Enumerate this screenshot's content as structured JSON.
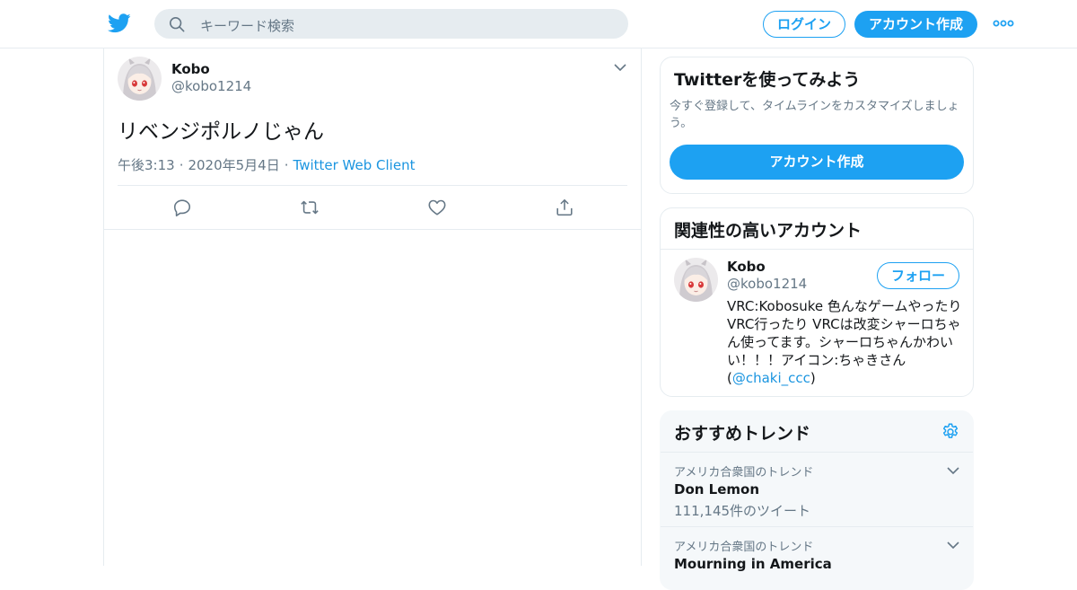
{
  "header": {
    "search_placeholder": "キーワード検索",
    "login_label": "ログイン",
    "signup_label": "アカウント作成",
    "brand_color": "#1da1f2"
  },
  "tweet": {
    "author_name": "Kobo",
    "author_handle": "@kobo1214",
    "text": "リベンジポルノじゃん",
    "time": "午後3:13",
    "date": "2020年5月4日",
    "client": "Twitter Web Client",
    "actions": [
      "reply-icon",
      "retweet-icon",
      "like-icon",
      "share-icon"
    ]
  },
  "sidebar": {
    "signup_card": {
      "title": "Twitterを使ってみよう",
      "description": "今すぐ登録して、タイムラインをカスタマイズしましょう。",
      "button_label": "アカウント作成"
    },
    "related_card": {
      "title": "関連性の高いアカウント",
      "account": {
        "name": "Kobo",
        "handle": "@kobo1214",
        "follow_label": "フォロー",
        "bio_text": "VRC:Kobosuke 色んなゲームやったりVRC行ったり VRCは改変シャーロちゃん使ってます。シャーロちゃんかわいい！！！アイコン:ちゃきさん(",
        "bio_mention": "@chaki_ccc",
        "bio_end": ")"
      }
    },
    "trends_card": {
      "title": "おすすめトレンド",
      "items": [
        {
          "location": "アメリカ合衆国のトレンド",
          "name": "Don Lemon",
          "count": "111,145件のツイート"
        },
        {
          "location": "アメリカ合衆国のトレンド",
          "name": "Mourning in America",
          "count": ""
        }
      ]
    }
  }
}
